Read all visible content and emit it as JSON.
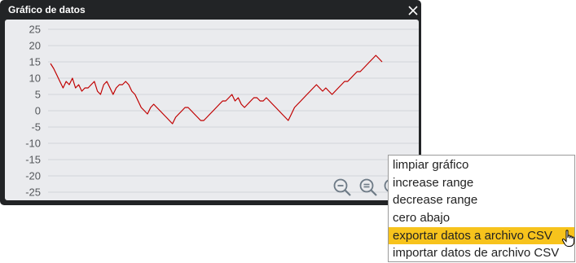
{
  "window": {
    "title": "Gráfico de datos",
    "close_icon": "close-icon"
  },
  "chart_data": {
    "type": "line",
    "title": "",
    "xlabel": "",
    "ylabel": "",
    "ylim": [
      -25,
      25
    ],
    "yticks": [
      25,
      20,
      15,
      10,
      5,
      0,
      -5,
      -10,
      -15,
      -20,
      -25
    ],
    "grid": true,
    "series": [
      {
        "color": "#c00000",
        "values": [
          14.5,
          13,
          11,
          9,
          7,
          9,
          8,
          10,
          7,
          8,
          6,
          7,
          7,
          8,
          9,
          6,
          5,
          8,
          9,
          7,
          5,
          7,
          8,
          8,
          9,
          8,
          6,
          5,
          3,
          1,
          0,
          -1,
          1,
          2,
          1,
          0,
          -1,
          -2,
          -3,
          -4,
          -2,
          -1,
          0,
          1,
          1,
          0,
          -1,
          -2,
          -3,
          -3,
          -2,
          -1,
          0,
          1,
          2,
          3,
          3,
          4,
          5,
          3,
          4,
          2,
          1,
          2,
          3,
          4,
          4,
          3,
          3,
          4,
          3,
          2,
          1,
          0,
          -1,
          -2,
          -3,
          -1,
          1,
          2,
          3,
          4,
          5,
          6,
          7,
          8,
          7,
          6,
          7,
          6,
          5,
          6,
          7,
          8,
          9,
          9,
          10,
          11,
          12,
          12,
          13,
          14,
          15,
          16,
          17,
          16,
          15
        ]
      }
    ]
  },
  "context_menu": {
    "items": [
      "limpiar gráfico",
      "increase range",
      "decrease range",
      "cero abajo",
      "exportar datos a archivo CSV",
      "importar datos de archivo CSV"
    ],
    "highlighted_index": 4,
    "highlight_color": "#f7c31c"
  },
  "icons": {
    "zoom_out": "zoom-out-icon",
    "zoom_reset": "zoom-reset-icon",
    "zoom_in": "zoom-in-icon",
    "cursor": "hand-pointer-icon"
  }
}
